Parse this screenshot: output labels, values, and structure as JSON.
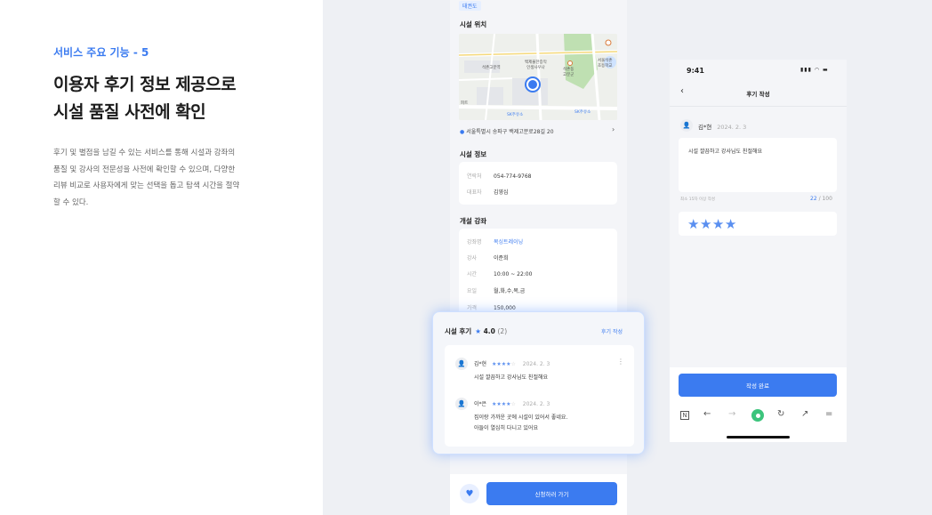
{
  "intro": {
    "eyebrow": "서비스 주요 기능 - 5",
    "headline_line1": "이용자 후기 정보 제공으로",
    "headline_line2": "시설 품질 사전에 확인",
    "desc_lines": [
      "후기 및 별점을 남길 수 있는 서비스를 통해 시설과 강좌의",
      "품질 및 강사의 전문성을 사전에 확인할 수 있으며, 다양한",
      "리뷰 비교로 사용자에게 맞는 선택을 돕고 탐색 시간을 절약",
      "할 수 있다."
    ]
  },
  "detail_screen": {
    "tag": "태권도",
    "location_title": "시설 위치",
    "map_labels": {
      "station1": "석촌고분역",
      "center": "백제불한증막\n인생사우나",
      "place": "석촌동\n고분군",
      "school": "서울석촌\n초등학교",
      "gas1": "SK주유소",
      "gas2": "SK주유소",
      "left": "피트"
    },
    "address": "서울특별시 송파구 백제고분로28길 20",
    "info_title": "시설 정보",
    "info_rows": [
      {
        "key": "연락처",
        "value": "054-774-9768"
      },
      {
        "key": "대표자",
        "value": "김영심"
      }
    ],
    "course_title": "개설 강좌",
    "course_rows": [
      {
        "key": "강좌명",
        "value": "복싱트레이닝"
      },
      {
        "key": "강사",
        "value": "이준희"
      },
      {
        "key": "시간",
        "value": "10:00 ~ 22:00"
      },
      {
        "key": "요일",
        "value": "월,화,수,목,금"
      },
      {
        "key": "가격",
        "value": "150,000"
      }
    ],
    "apply_label": "신청하러 가기",
    "heart_icon": "heart-icon"
  },
  "review_popup": {
    "title": "시설 후기",
    "rating": "4.0",
    "count": "(2)",
    "write_label": "후기 작성",
    "reviews": [
      {
        "name": "김*현",
        "stars_filled": "★★★★",
        "stars_empty": "☆",
        "date": "2024. 2. 3",
        "lines": [
          "시설 깔끔하고 강사님도 친절해요"
        ]
      },
      {
        "name": "이*은",
        "stars_filled": "★★★★",
        "stars_empty": "☆",
        "date": "2024. 2. 3",
        "lines": [
          "집이랑 가까운 곳에 시설이 있어서 좋네요.",
          "아들이 열심히 다니고 있어요"
        ]
      }
    ]
  },
  "write_screen": {
    "time": "9:41",
    "status_icons": "▮▮▮ ◠ ▬",
    "title": "후기 작성",
    "author": "김*현",
    "date": "2024. 2. 3",
    "text": "시설 깔끔하고 강사님도 친절해요",
    "hint": "최소 15자 이상 작성",
    "count_current": "22",
    "count_max": "/ 100",
    "rating_stars": "★★★★",
    "done_label": "작성 완료",
    "nav_icons": [
      "N",
      "←",
      "→",
      "↻",
      "↗",
      "="
    ]
  },
  "colors": {
    "accent": "#3b7bf0",
    "background": "#eef0f4",
    "star": "#5a8ff0",
    "nav_green": "#3cc47c"
  }
}
